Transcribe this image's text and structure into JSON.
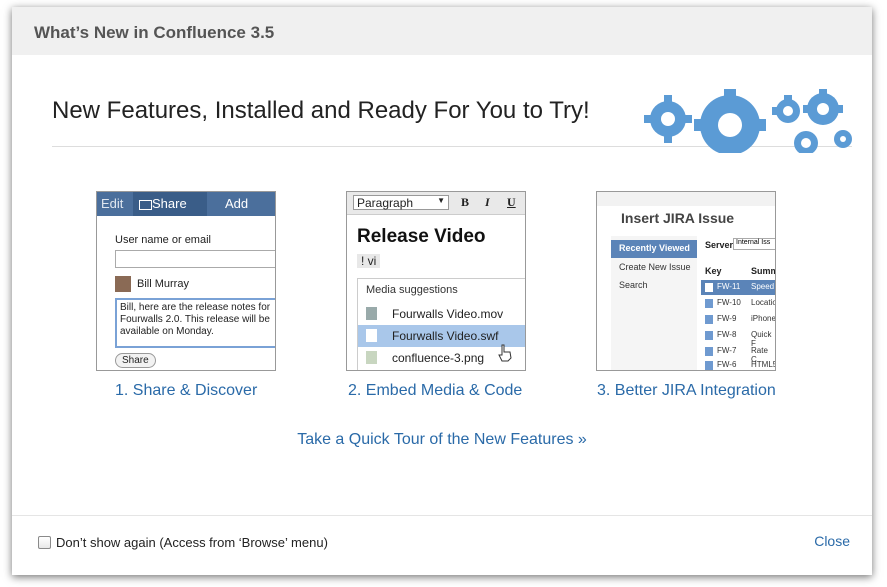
{
  "window": {
    "title": "What’s New in Confluence 3.5"
  },
  "headline": "New Features, Installed and Ready For You to Try!",
  "features": [
    {
      "caption": "1. Share & Discover"
    },
    {
      "caption": "2. Embed Media & Code"
    },
    {
      "caption": "3. Better JIRA Integration"
    }
  ],
  "share_thumb": {
    "edit": "Edit",
    "share": "Share",
    "add": "Add",
    "user_label": "User name or email",
    "person": "Bill Murray",
    "message": "Bill, here are the release notes for\nFourwalls 2.0. This release will be\navailable on Monday.",
    "button": "Share"
  },
  "media_thumb": {
    "style": "Paragraph",
    "bold": "B",
    "italic": "I",
    "underline": "U",
    "title": "Release Video",
    "macro": "! vi",
    "menu_header": "Media suggestions",
    "items": [
      "Fourwalls Video.mov",
      "Fourwalls Video.swf",
      "confluence-3.png"
    ]
  },
  "jira_thumb": {
    "title": "Insert JIRA Issue",
    "sidebar": [
      "Recently Viewed",
      "Create New Issue",
      "Search"
    ],
    "server_label": "Server",
    "server_value": "Internal Iss",
    "col_key": "Key",
    "col_summary": "Summ",
    "rows": [
      {
        "key": "FW-11",
        "summary": "Speed"
      },
      {
        "key": "FW-10",
        "summary": "Locatio"
      },
      {
        "key": "FW-9",
        "summary": "iPhone"
      },
      {
        "key": "FW-8",
        "summary": "Quick F"
      },
      {
        "key": "FW-7",
        "summary": "Rate C"
      },
      {
        "key": "FW-6",
        "summary": "HTML5"
      }
    ]
  },
  "tour_link": "Take a Quick Tour of the New Features »",
  "footer": {
    "dont_show": "Don’t show again (Access from ‘Browse’ menu)",
    "close": "Close"
  },
  "colors": {
    "link": "#2a6aa8",
    "gear": "#5b9bd5",
    "header_bg": "#f0f0f0"
  }
}
